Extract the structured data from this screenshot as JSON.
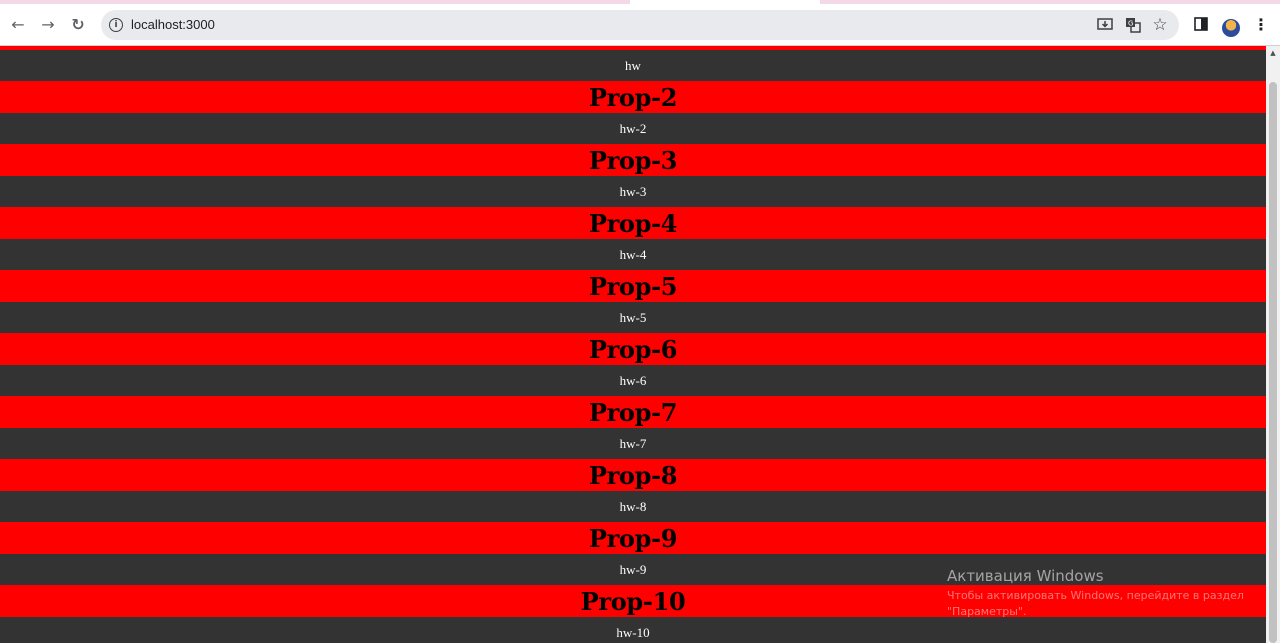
{
  "browser": {
    "url": "localhost:3000",
    "icons": {
      "back": "arrow-left-icon",
      "forward": "arrow-right-icon",
      "reload": "reload-icon",
      "site_info": "info-icon",
      "install": "install-app-icon",
      "translate": "translate-icon",
      "bookmark": "star-icon",
      "side_panel": "side-panel-icon",
      "profile": "avatar",
      "menu": "kebab-menu-icon"
    }
  },
  "page": {
    "colors": {
      "prop_bg": "#ff0000",
      "hw_bg": "#333333"
    },
    "partial_top_hw": "hw",
    "items": [
      {
        "title": "Prop-2",
        "text": "hw-2"
      },
      {
        "title": "Prop-3",
        "text": "hw-3"
      },
      {
        "title": "Prop-4",
        "text": "hw-4"
      },
      {
        "title": "Prop-5",
        "text": "hw-5"
      },
      {
        "title": "Prop-6",
        "text": "hw-6"
      },
      {
        "title": "Prop-7",
        "text": "hw-7"
      },
      {
        "title": "Prop-8",
        "text": "hw-8"
      },
      {
        "title": "Prop-9",
        "text": "hw-9"
      },
      {
        "title": "Prop-10",
        "text": "hw-10"
      }
    ]
  },
  "watermark": {
    "title": "Активация Windows",
    "text": "Чтобы активировать Windows, перейдите в раздел \"Параметры\"."
  }
}
